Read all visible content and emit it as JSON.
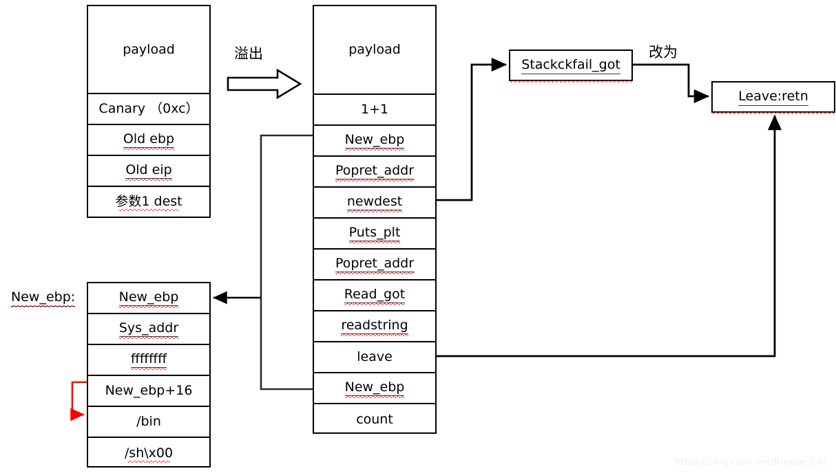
{
  "diagram": {
    "title": "Stack overflow ROP payload layout",
    "watermark": "https://blog.csdn.net/Breeze_CAT",
    "colors": {
      "stroke": "#000000",
      "accent_red": "#ff0000",
      "spellcheck_red": "#ff2020",
      "background": "#ffffff",
      "watermark": "#eceff1"
    }
  },
  "original_stack": {
    "name": "original-stack",
    "rows": [
      {
        "label": "payload",
        "misspelled": false
      },
      {
        "label": "Canary （0xc）",
        "misspelled": false
      },
      {
        "label": "Old ebp",
        "misspelled": true
      },
      {
        "label": "Old eip",
        "misspelled": true
      },
      {
        "label": "参数1 dest",
        "misspelled": true
      }
    ]
  },
  "overflow_arrow": {
    "label": "溢出",
    "icon": "block-arrow-right-icon"
  },
  "overflow_stack": {
    "name": "overflow-stack",
    "rows": [
      {
        "label": "payload",
        "misspelled": false
      },
      {
        "label": "1+1",
        "misspelled": false
      },
      {
        "label": "New_ebp",
        "misspelled": true
      },
      {
        "label": "Popret_addr",
        "misspelled": true
      },
      {
        "label": "newdest",
        "misspelled": true
      },
      {
        "label": "Puts_plt",
        "misspelled": true
      },
      {
        "label": "Popret_addr",
        "misspelled": true
      },
      {
        "label": "Read_got",
        "misspelled": true
      },
      {
        "label": "readstring",
        "misspelled": true
      },
      {
        "label": "leave",
        "misspelled": false
      },
      {
        "label": "New_ebp",
        "misspelled": true
      },
      {
        "label": "count",
        "misspelled": false
      }
    ]
  },
  "fake_frame": {
    "name": "fake-stack-frame",
    "side_label": "New_ebp:",
    "rows": [
      {
        "label": "New_ebp",
        "misspelled": true
      },
      {
        "label": "Sys_addr",
        "misspelled": true
      },
      {
        "label": "ffffffff",
        "misspelled": true
      },
      {
        "label": "New_ebp+16",
        "misspelled": false
      },
      {
        "label": "/bin",
        "misspelled": false
      },
      {
        "label": "/sh\\x00",
        "misspelled": true
      }
    ]
  },
  "right_nodes": {
    "got_entry": {
      "label": "Stackckfail_got",
      "misspelled": true
    },
    "transform_label": "改为",
    "gadget": {
      "label": "Leave:retn",
      "misspelled": true
    }
  }
}
